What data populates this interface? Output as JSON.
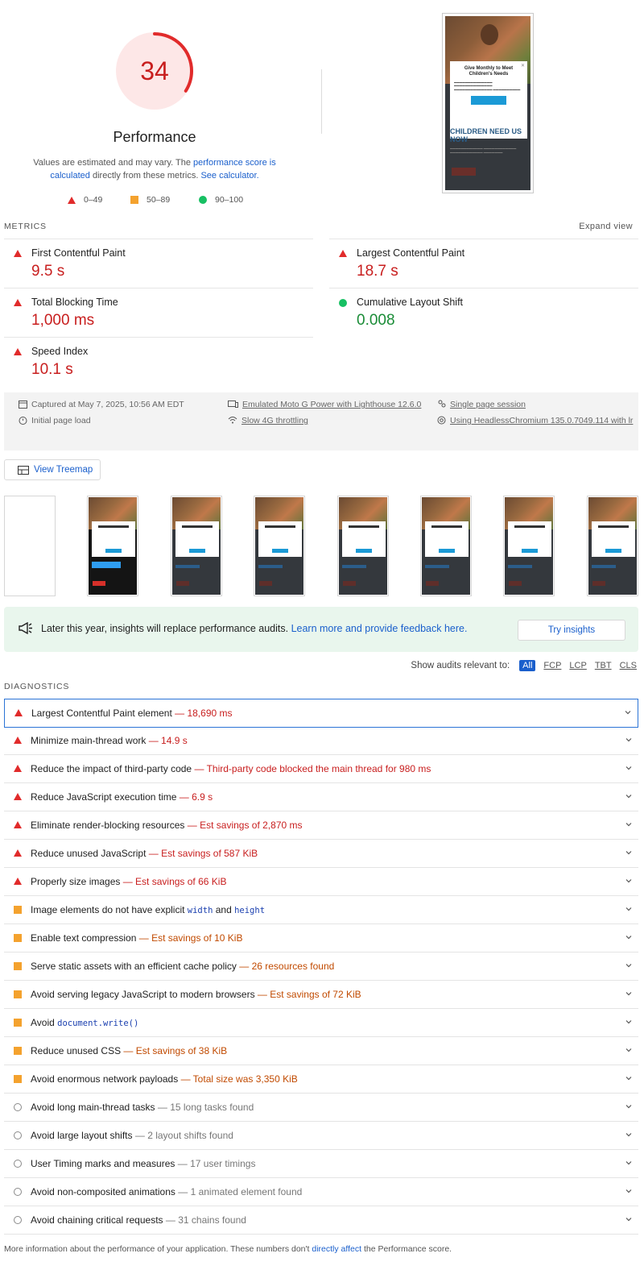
{
  "score": {
    "value": "34",
    "fraction": 0.34,
    "title": "Performance"
  },
  "note": {
    "prefix": "Values are estimated and may vary. The ",
    "link1": "performance score is calculated",
    "middle": " directly from these metrics. ",
    "link2": "See calculator."
  },
  "legend": {
    "fail": "0–49",
    "average": "50–89",
    "pass": "90–100"
  },
  "phone": {
    "modal_title": "Give Monthly to Meet Children's Needs",
    "heading": "CHILDREN NEED US NOW"
  },
  "metrics": {
    "label": "METRICS",
    "expand": "Expand view",
    "items": [
      {
        "name": "First Contentful Paint",
        "value": "9.5 s",
        "status": "fail"
      },
      {
        "name": "Largest Contentful Paint",
        "value": "18.7 s",
        "status": "fail"
      },
      {
        "name": "Total Blocking Time",
        "value": "1,000 ms",
        "status": "fail"
      },
      {
        "name": "Cumulative Layout Shift",
        "value": "0.008",
        "status": "pass"
      },
      {
        "name": "Speed Index",
        "value": "10.1 s",
        "status": "fail"
      }
    ]
  },
  "runtime": {
    "captured": "Captured at May 7, 2025, 10:56 AM EDT",
    "load": "Initial page load",
    "device": "Emulated Moto G Power with Lighthouse 12.6.0",
    "throttle": "Slow 4G throttling",
    "session": "Single page session",
    "browser": "Using HeadlessChromium 135.0.7049.114 with lr"
  },
  "treemap": {
    "label": "View Treemap"
  },
  "banner": {
    "text": "Later this year, insights will replace performance audits. ",
    "link": "Learn more and provide feedback here.",
    "button": "Try insights"
  },
  "filter": {
    "label": "Show audits relevant to:",
    "chips": [
      "All",
      "FCP",
      "LCP",
      "TBT",
      "CLS"
    ]
  },
  "diagnostics": {
    "label": "DIAGNOSTICS",
    "audits": [
      {
        "title": "Largest Contentful Paint element",
        "detail": "— 18,690 ms",
        "status": "fail"
      },
      {
        "title": "Minimize main-thread work",
        "detail": "— 14.9 s",
        "status": "fail"
      },
      {
        "title": "Reduce the impact of third-party code",
        "detail": "— Third-party code blocked the main thread for 980 ms",
        "status": "fail"
      },
      {
        "title": "Reduce JavaScript execution time",
        "detail": "— 6.9 s",
        "status": "fail"
      },
      {
        "title": "Eliminate render-blocking resources",
        "detail": "— Est savings of 2,870 ms",
        "status": "fail"
      },
      {
        "title": "Reduce unused JavaScript",
        "detail": "— Est savings of 587 KiB",
        "status": "fail"
      },
      {
        "title": "Properly size images",
        "detail": "— Est savings of 66 KiB",
        "status": "fail"
      },
      {
        "title": "Image elements do not have explicit ",
        "code1": "width",
        "mid": " and ",
        "code2": "height",
        "detail": "",
        "status": "average"
      },
      {
        "title": "Enable text compression",
        "detail": "— Est savings of 10 KiB",
        "status": "average"
      },
      {
        "title": "Serve static assets with an efficient cache policy",
        "detail": "— 26 resources found",
        "status": "average"
      },
      {
        "title": "Avoid serving legacy JavaScript to modern browsers",
        "detail": "— Est savings of 72 KiB",
        "status": "average"
      },
      {
        "title": "Avoid ",
        "code1": "document.write()",
        "detail": "",
        "status": "average"
      },
      {
        "title": "Reduce unused CSS",
        "detail": "— Est savings of 38 KiB",
        "status": "average"
      },
      {
        "title": "Avoid enormous network payloads",
        "detail": "— Total size was 3,350 KiB",
        "status": "average"
      },
      {
        "title": "Avoid long main-thread tasks",
        "detail": "— 15 long tasks found",
        "status": "info"
      },
      {
        "title": "Avoid large layout shifts",
        "detail": "— 2 layout shifts found",
        "status": "info"
      },
      {
        "title": "User Timing marks and measures",
        "detail": "— 17 user timings",
        "status": "info"
      },
      {
        "title": "Avoid non-composited animations",
        "detail": "— 1 animated element found",
        "status": "info"
      },
      {
        "title": "Avoid chaining critical requests",
        "detail": "— 31 chains found",
        "status": "info"
      }
    ]
  },
  "footer": {
    "prefix": "More information about the performance of your application. These numbers don't ",
    "link": "directly affect",
    "suffix": " the Performance score."
  },
  "colors": {
    "fail": "#e12b2b",
    "average": "#f4a22e",
    "pass": "#17c063",
    "accent": "#1a5fcc"
  }
}
